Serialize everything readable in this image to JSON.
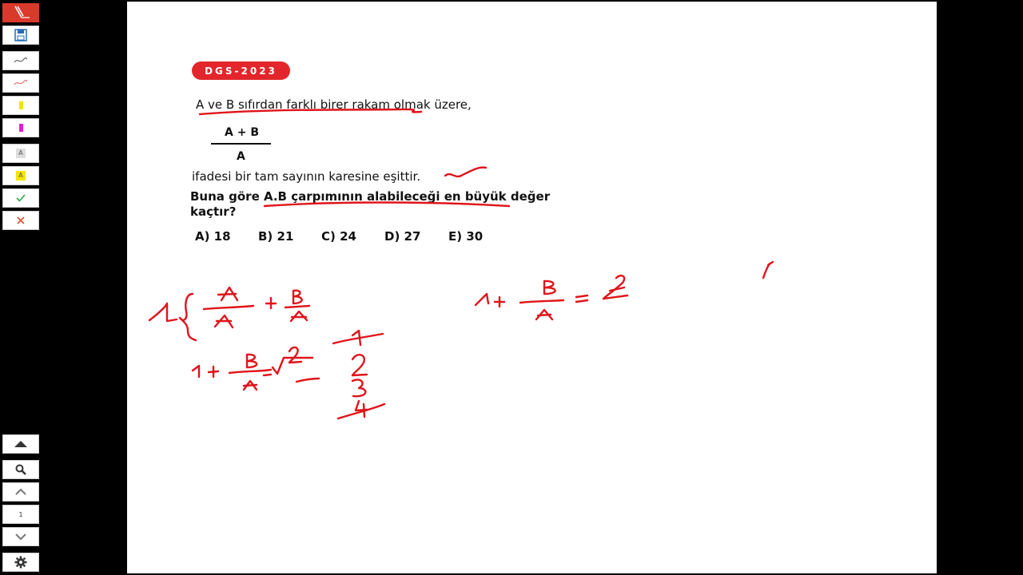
{
  "toolbar": {
    "page_number": "1"
  },
  "question": {
    "badge": "DGS-2023",
    "line1": "A ve B sıfırdan farklı birer rakam olmak üzere,",
    "fraction_numerator": "A + B",
    "fraction_denominator": "A",
    "line2": "ifadesi bir tam sayının karesine eşittir.",
    "line3": "Buna göre A.B çarpımının alabileceği en büyük değer kaçtır?",
    "options": [
      "A) 18",
      "B) 21",
      "C) 24",
      "D) 27",
      "E) 30"
    ]
  },
  "colors": {
    "accent": "#e2262b",
    "ink": "#e0141b",
    "check": "#2aa845"
  }
}
